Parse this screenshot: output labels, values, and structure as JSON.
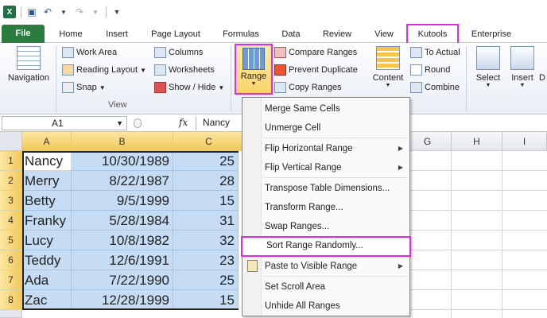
{
  "app": {
    "logo_letter": "X"
  },
  "tabs": [
    "File",
    "Home",
    "Insert",
    "Page Layout",
    "Formulas",
    "Data",
    "Review",
    "View",
    "Kutools",
    "Enterprise"
  ],
  "ribbon": {
    "navigation": "Navigation",
    "work_area": "Work Area",
    "reading_layout": "Reading Layout",
    "snap": "Snap",
    "columns": "Columns",
    "worksheets": "Worksheets",
    "show_hide": "Show / Hide",
    "view_group": "View",
    "range": "Range",
    "compare_ranges": "Compare Ranges",
    "prevent_duplicate": "Prevent Duplicate",
    "copy_ranges": "Copy Ranges",
    "content": "Content",
    "to_actual": "To Actual",
    "round": "Round",
    "combine": "Combine",
    "select": "Select",
    "insert": "Insert",
    "partial": "D"
  },
  "formula_bar": {
    "name_box": "A1",
    "fx": "fx",
    "content": "Nancy"
  },
  "columns": [
    "A",
    "B",
    "C",
    "G",
    "H",
    "I"
  ],
  "rows": [
    {
      "num": "1",
      "name": "Nancy",
      "date": "10/30/1989",
      "val": "25"
    },
    {
      "num": "2",
      "name": "Merry",
      "date": "8/22/1987",
      "val": "28"
    },
    {
      "num": "3",
      "name": "Betty",
      "date": "9/5/1999",
      "val": "15"
    },
    {
      "num": "4",
      "name": "Franky",
      "date": "5/28/1984",
      "val": "31"
    },
    {
      "num": "5",
      "name": "Lucy",
      "date": "10/8/1982",
      "val": "32"
    },
    {
      "num": "6",
      "name": "Teddy",
      "date": "12/6/1991",
      "val": "23"
    },
    {
      "num": "7",
      "name": "Ada",
      "date": "7/22/1990",
      "val": "25"
    },
    {
      "num": "8",
      "name": "Zac",
      "date": "12/28/1999",
      "val": "15"
    }
  ],
  "menu": [
    "Merge Same Cells",
    "Unmerge Cell",
    "Flip Horizontal Range",
    "Flip Vertical Range",
    "Transpose Table Dimensions...",
    "Transform Range...",
    "Swap Ranges...",
    "Sort Range Randomly...",
    "Paste to Visible Range",
    "Set Scroll Area",
    "Unhide All Ranges"
  ],
  "colors": {
    "highlight": "#e228e8",
    "selection": "#c5dcf4",
    "file_tab": "#2a7d3f"
  }
}
